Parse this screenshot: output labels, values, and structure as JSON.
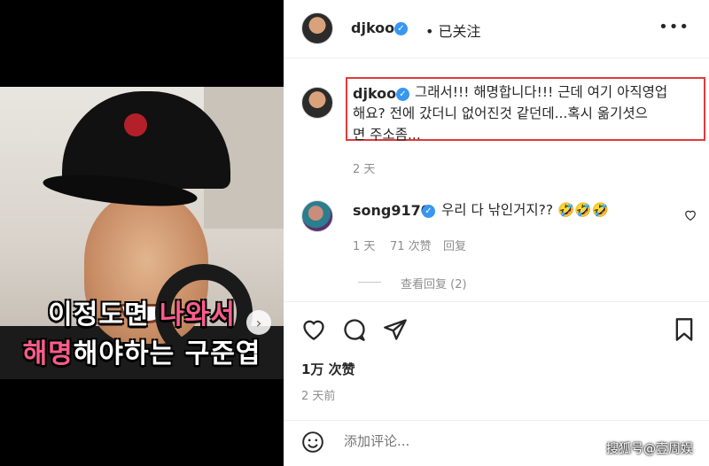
{
  "media": {
    "caption_line1_white": "이정도면 ",
    "caption_line1_pink": "나와서",
    "caption_line2_pink": "해명",
    "caption_line2_white": "해야하는 구준엽"
  },
  "header": {
    "username": "djkoo",
    "follow_state": "已关注",
    "more_icon": "•••"
  },
  "comments": [
    {
      "username": "djkoo",
      "text_line1": "그래서!!! 해명합니다!!! 근데 여기 아직영업",
      "text_line2": "해요? 전에 갔더니 없어진것 같던데...혹시 옮기셧으",
      "text_line3": "면 주소좀...",
      "time": "2 天"
    },
    {
      "username": "song9170",
      "text": "우리 다 낚인거지?? 🤣🤣🤣",
      "time": "1 天",
      "likes": "71 次赞",
      "reply": "回复",
      "view_replies": "查看回复 (2)"
    }
  ],
  "post": {
    "likes": "1万 次赞",
    "posted": "2 天前"
  },
  "composer": {
    "placeholder": "添加评论..."
  },
  "watermark": "搜狐号@壹周娱",
  "colors": {
    "highlight_border": "#e03a3a",
    "verified_blue": "#3897f0",
    "caption_pink": "#ff5c8d"
  }
}
